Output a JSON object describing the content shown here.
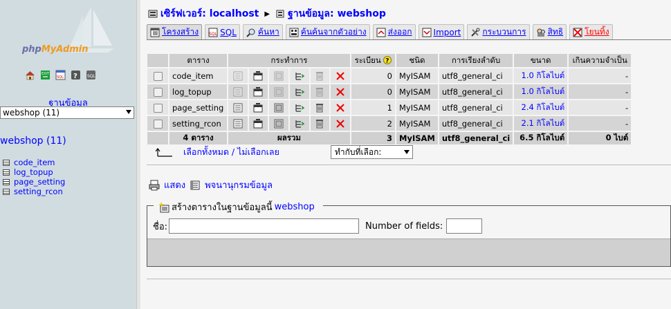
{
  "nav": {
    "logo_php": "php",
    "logo_myadmin": "MyAdmin",
    "quick_icons": [
      "home-icon",
      "exit-icon",
      "sql-icon",
      "help-icon",
      "docs-icon"
    ],
    "db_label": "ฐานข้อมูล",
    "db_selected": "webshop (11)",
    "db_title": "webshop (11)",
    "tables": [
      "code_item",
      "log_topup",
      "page_setting",
      "setting_rcon"
    ]
  },
  "header": {
    "server": "เซิร์ฟเวอร์: localhost",
    "database": "ฐานข้อมูล: webshop"
  },
  "tabs": [
    {
      "label": "โครงสร้าง",
      "icon": "structure-icon"
    },
    {
      "label": "SQL",
      "icon": "sql-icon"
    },
    {
      "label": "ค้นหา",
      "icon": "search-icon"
    },
    {
      "label": "ค้นค้นจากตัวอย่าง",
      "icon": "query-icon"
    },
    {
      "label": "ส่งออก",
      "icon": "export-icon"
    },
    {
      "label": "Import",
      "icon": "import-icon"
    },
    {
      "label": "กระบวนการ",
      "icon": "operations-icon"
    },
    {
      "label": "สิทธิ",
      "icon": "privileges-icon"
    },
    {
      "label": "โยนทิ้ง",
      "icon": "drop-icon"
    }
  ],
  "table": {
    "headers": {
      "table": "ตาราง",
      "action": "กระทำการ",
      "records": "ระเบียน",
      "type": "ชนิด",
      "collation": "การเรียงลำดับ",
      "size": "ขนาด",
      "overhead": "เกินความจำเป็น"
    },
    "rows": [
      {
        "name": "code_item",
        "records": "0",
        "type": "MyISAM",
        "collation": "utf8_general_ci",
        "size": "1.0 กิโลไบต์",
        "overhead": "-"
      },
      {
        "name": "log_topup",
        "records": "0",
        "type": "MyISAM",
        "collation": "utf8_general_ci",
        "size": "1.0 กิโลไบต์",
        "overhead": "-"
      },
      {
        "name": "page_setting",
        "records": "1",
        "type": "MyISAM",
        "collation": "utf8_general_ci",
        "size": "2.4 กิโลไบต์",
        "overhead": "-"
      },
      {
        "name": "setting_rcon",
        "records": "2",
        "type": "MyISAM",
        "collation": "utf8_general_ci",
        "size": "2.1 กิโลไบต์",
        "overhead": "-"
      }
    ],
    "total": {
      "tables": "4 ตาราง",
      "label": "ผลรวม",
      "records": "3",
      "type": "MyISAM",
      "collation": "utf8_general_ci",
      "size": "6.5 กิโลไบต์",
      "overhead": "0 ไบต์"
    }
  },
  "select_all": "เลือกทั้งหมด / ไม่เลือกเลย",
  "with_selected": "ทำกับที่เลือก:",
  "print_view": "แสดง",
  "data_dictionary": "พจนานุกรมข้อมูล",
  "create": {
    "legend": "สร้างตารางในฐานข้อมูลนี้",
    "db": "webshop",
    "name_label": "ชื่อ:",
    "fields_label": "Number of fields:"
  },
  "colors": {
    "link": "#0000ff",
    "nav_bg": "#d0dce0",
    "row_odd": "#e6e6e6",
    "row_even": "#d5d5d5",
    "drop": "#ff0000"
  }
}
